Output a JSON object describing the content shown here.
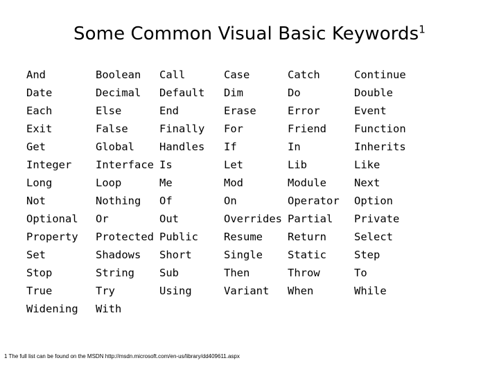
{
  "slide": {
    "title_text": "Some Common Visual Basic Keywords",
    "title_superscript": "1",
    "footnote": "1 The full list can be found on the MSDN http://msdn.microsoft.com/en-us/library/dd409611.aspx"
  },
  "keywords": {
    "columns": [
      [
        "And",
        "Date",
        "Each",
        "Exit",
        "Get",
        "Integer",
        "Long",
        "Not",
        "Optional",
        "Property",
        "Set",
        "Stop",
        "True",
        "Widening"
      ],
      [
        "Boolean",
        "Decimal",
        "Else",
        "False",
        "Global",
        "Interface",
        "Loop",
        "Nothing",
        "Or",
        "Protected",
        "Shadows",
        "String",
        "Try",
        "With"
      ],
      [
        "Call",
        "Default",
        "End",
        "Finally",
        "Handles",
        "Is",
        "Me",
        "Of",
        "Out",
        "Public",
        "Short",
        "Sub",
        "Using",
        ""
      ],
      [
        "Case",
        "Dim",
        "Erase",
        "For",
        "If",
        "Let",
        "Mod",
        "On",
        "Overrides",
        "Resume",
        "Single",
        "Then",
        "Variant",
        ""
      ],
      [
        "Catch",
        "Do",
        "Error",
        "Friend",
        "In",
        "Lib",
        "Module",
        "Operator",
        "Partial",
        "Return",
        "Static",
        "Throw",
        "When",
        ""
      ],
      [
        "Continue",
        "Double",
        "Event",
        "Function",
        "Inherits",
        "Like",
        "Next",
        "Option",
        "Private",
        "Select",
        "Step",
        "To",
        "While",
        ""
      ]
    ],
    "rows": [
      [
        "And",
        "Boolean",
        "Call",
        "Case",
        "Catch",
        "Continue"
      ],
      [
        "Date",
        "Decimal",
        "Default",
        "Dim",
        "Do",
        "Double"
      ],
      [
        "Each",
        "Else",
        "End",
        "Erase",
        "Error",
        "Event"
      ],
      [
        "Exit",
        "False",
        "Finally",
        "For",
        "Friend",
        "Function"
      ],
      [
        "Get",
        "Global",
        "Handles",
        "If",
        "In",
        "Inherits"
      ],
      [
        "Integer",
        "Interface",
        "Is",
        "Let",
        "Lib",
        "Like"
      ],
      [
        "Long",
        "Loop",
        "Me",
        "Mod",
        "Module",
        "Next"
      ],
      [
        "Not",
        "Nothing",
        "Of",
        "On",
        "Operator",
        "Option"
      ],
      [
        "Optional",
        "Or",
        "Out",
        "Overrides",
        "Partial",
        "Private"
      ],
      [
        "Property",
        "Protected",
        "Public",
        "Resume",
        "Return",
        "Select"
      ],
      [
        "Set",
        "Shadows",
        "Short",
        "Single",
        "Static",
        "Step"
      ],
      [
        "Stop",
        "String",
        "Sub",
        "Then",
        "Throw",
        "To"
      ],
      [
        "True",
        "Try",
        "Using",
        "Variant",
        "When",
        "While"
      ],
      [
        "Widening",
        "With",
        "",
        "",
        "",
        ""
      ]
    ]
  }
}
